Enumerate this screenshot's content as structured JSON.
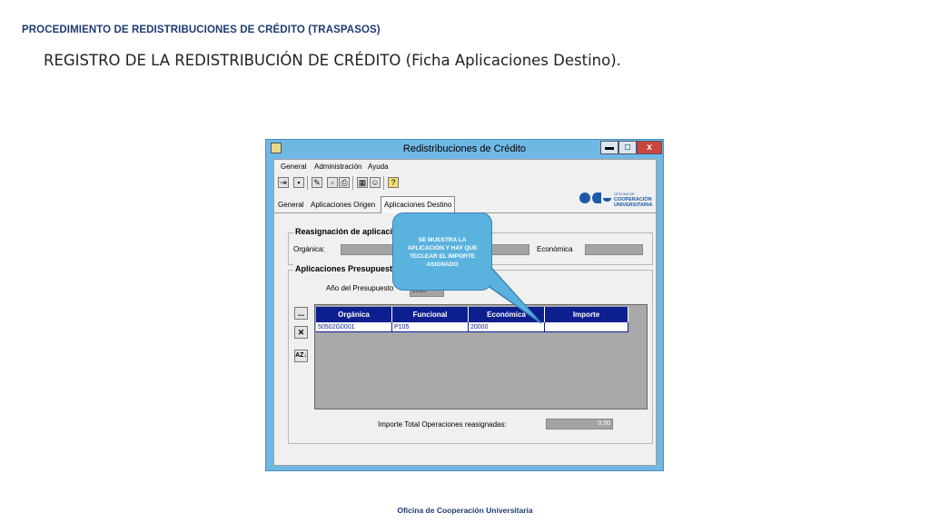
{
  "slide": {
    "header": "PROCEDIMIENTO DE REDISTRIBUCIONES DE CRÉDITO (TRASPASOS)",
    "title": "REGISTRO DE LA REDISTRIBUCIÓN DE CRÉDITO (Ficha Aplicaciones Destino).",
    "footer": "Oficina de Cooperación Universitaria"
  },
  "window": {
    "title": "Redistribuciones de Crédito",
    "controls": {
      "minimize": "▬",
      "maximize": "□",
      "close": "x"
    }
  },
  "menu": [
    "General",
    "Administración",
    "Ayuda"
  ],
  "toolbar_icons": [
    "exit-icon",
    "save-icon",
    "edit-icon",
    "preview-icon",
    "print-icon",
    "calculator-icon",
    "users-icon",
    "help-icon"
  ],
  "logo": {
    "line1": "OFICINA DE",
    "line2": "COOPERACIÓN",
    "line3": "UNIVERSITARIA"
  },
  "tabs": [
    {
      "label": "General",
      "active": false
    },
    {
      "label": "Aplicaciones Origen",
      "active": false
    },
    {
      "label": "Aplicaciones Destino",
      "active": true
    }
  ],
  "reasignacion": {
    "legend": "Reasignación de aplicació",
    "organica_label": "Orgánica:",
    "economica_label": "Económica"
  },
  "presupuestarias": {
    "legend": "Aplicaciones Presupuesta",
    "anio_label": "Año del Presupuesto",
    "anio_value": "2015"
  },
  "side_buttons": {
    "add": "...",
    "delete": "✕",
    "sort": "AZ↓"
  },
  "grid": {
    "columns": [
      "Orgánica",
      "Funcional",
      "Económica",
      "Importe"
    ],
    "rows": [
      {
        "organica": "50502G0001",
        "funcional": "P105",
        "economica": "20000",
        "importe": ""
      }
    ]
  },
  "total": {
    "label": "Importe Total Operaciones reasignadas:",
    "value": "0,00"
  },
  "callout": {
    "text": "SE MUESTRA LA APLICACIÓN Y HAY QUE TECLEAR EL IMPORTE ASIGNADO"
  },
  "colors": {
    "header_blue": "#1f3b73",
    "grid_header": "#0d1f8f",
    "callout_fill": "#5ab2df",
    "window_frame": "#70b8e4"
  }
}
